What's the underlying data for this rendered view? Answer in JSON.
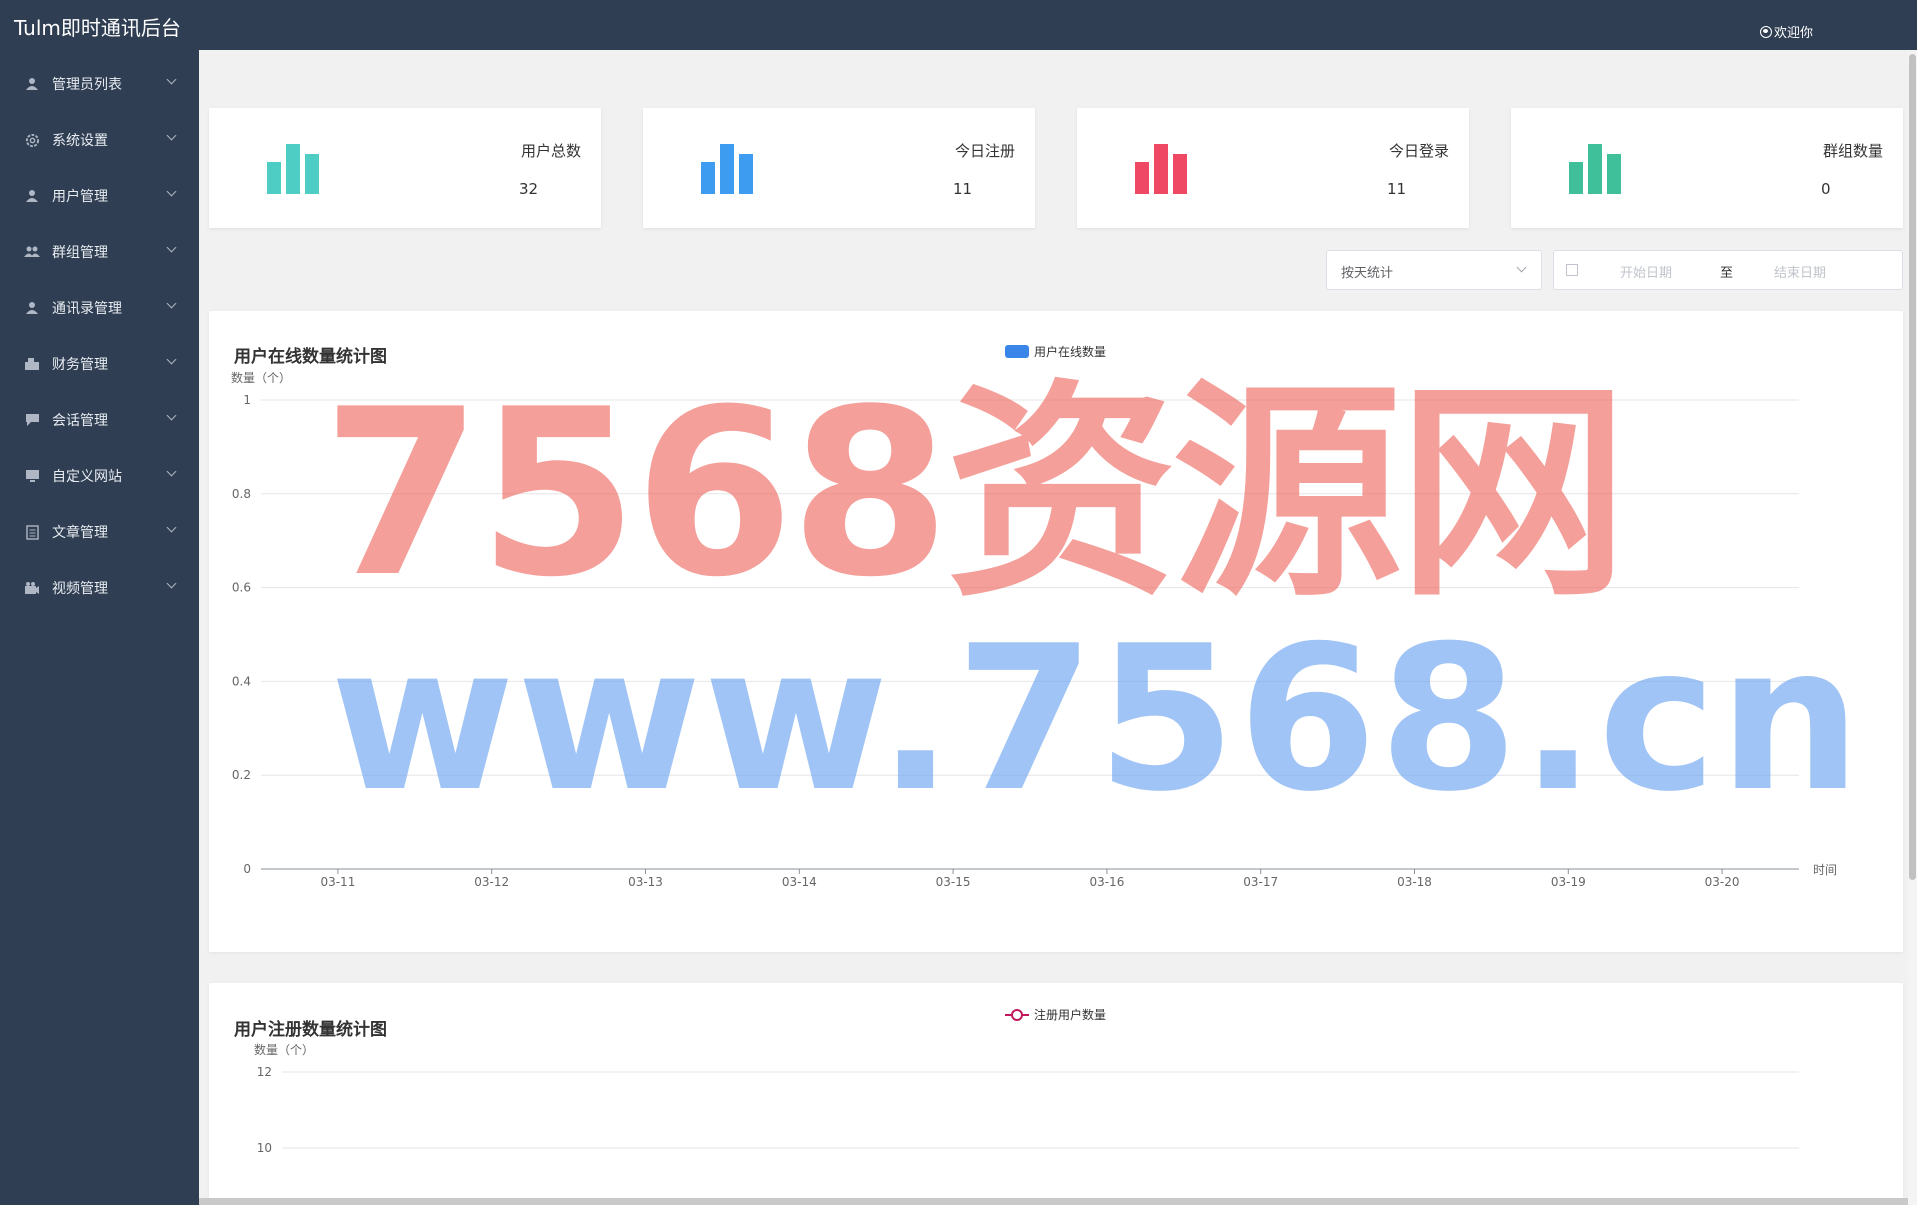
{
  "header": {
    "title": "Tulm即时通讯后台",
    "welcome": "欢迎你"
  },
  "sidebar": {
    "items": [
      {
        "label": "管理员列表",
        "icon": "user-icon"
      },
      {
        "label": "系统设置",
        "icon": "gear-icon"
      },
      {
        "label": "用户管理",
        "icon": "user-icon"
      },
      {
        "label": "群组管理",
        "icon": "group-icon"
      },
      {
        "label": "通讯录管理",
        "icon": "user-icon"
      },
      {
        "label": "财务管理",
        "icon": "finance-icon"
      },
      {
        "label": "会话管理",
        "icon": "chat-icon"
      },
      {
        "label": "自定义网站",
        "icon": "monitor-icon"
      },
      {
        "label": "文章管理",
        "icon": "document-icon"
      },
      {
        "label": "视频管理",
        "icon": "video-icon"
      }
    ]
  },
  "stats": [
    {
      "title": "用户总数",
      "value": "32",
      "color": "#4ecdc4"
    },
    {
      "title": "今日注册",
      "value": "11",
      "color": "#3e9cf0"
    },
    {
      "title": "今日登录",
      "value": "11",
      "color": "#ef4865"
    },
    {
      "title": "群组数量",
      "value": "0",
      "color": "#3fbf9a"
    }
  ],
  "filters": {
    "group_by": "按天统计",
    "start_placeholder": "开始日期",
    "separator": "至",
    "end_placeholder": "结束日期"
  },
  "chart_data": [
    {
      "type": "bar",
      "title": "用户在线数量统计图",
      "ylabel": "数量（个）",
      "xlabel": "时间",
      "legend": "用户在线数量",
      "legend_position": "top-center",
      "series_color": "#3a86e8",
      "categories": [
        "03-11",
        "03-12",
        "03-13",
        "03-14",
        "03-15",
        "03-16",
        "03-17",
        "03-18",
        "03-19",
        "03-20"
      ],
      "series": [
        {
          "name": "用户在线数量",
          "values": [
            0,
            0,
            0,
            0,
            0,
            0,
            0,
            0,
            0,
            0
          ]
        }
      ],
      "yticks": [
        "0",
        "0.2",
        "0.4",
        "0.6",
        "0.8",
        "1"
      ],
      "ylim": [
        0,
        1
      ],
      "grid": true
    },
    {
      "type": "line",
      "title": "用户注册数量统计图",
      "ylabel": "数量（个）",
      "legend": "注册用户数量",
      "legend_position": "top-center",
      "series_color": "#c2185b",
      "yticks_visible": [
        "12",
        "10"
      ],
      "grid": true
    }
  ],
  "watermark": {
    "line1": "7568资源网",
    "line2": "www.7568.cn"
  }
}
